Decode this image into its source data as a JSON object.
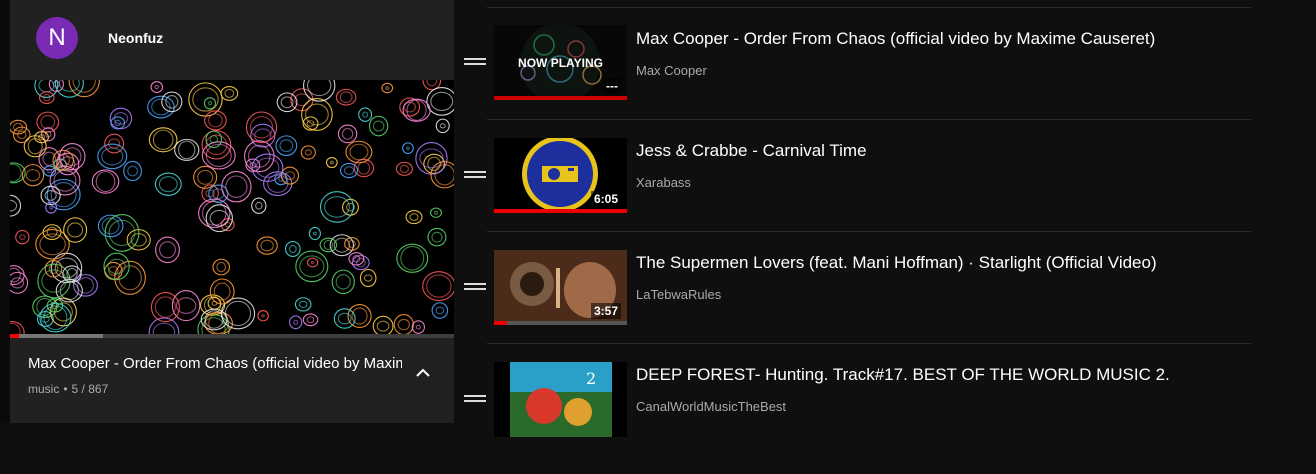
{
  "account": {
    "initial": "N",
    "name": "Neonfuz",
    "avatar_color": "#7a2bb5"
  },
  "now_playing": {
    "title": "Max Cooper - Order From Chaos (official video by Maxime Causeret)",
    "playlist_name": "music",
    "separator": "•",
    "position": "5 / 867",
    "progress_fraction": 0.02,
    "buffer_fraction": 0.21
  },
  "queue": [
    {
      "title": "Max Cooper - Order From Chaos (official video by Maxime Causeret)",
      "channel": "Max Cooper",
      "overlay": "NOW PLAYING",
      "duration": "---",
      "thumb_icon": "generative-art-thumbnail"
    },
    {
      "title": "Jess & Crabbe - Carnival Time",
      "channel": "Xarabass",
      "duration": "6:05",
      "thumb_icon": "turntable-emblem-thumbnail"
    },
    {
      "title": "The Supermen Lovers (feat. Mani Hoffman) · Starlight (Official Video)",
      "channel": "LaTebwaRules",
      "duration": "3:57",
      "thumb_icon": "music-video-thumbnail"
    },
    {
      "title": "DEEP FOREST- Hunting. Track#17. BEST OF THE WORLD MUSIC 2.",
      "channel": "CanalWorldMusicTheBest",
      "duration": "",
      "thumb_icon": "album-cover-thumbnail"
    }
  ],
  "colors": {
    "accent": "#ff0000",
    "background": "#0f0f0f",
    "panel": "#212121",
    "secondary_text": "#aaaaaa"
  }
}
